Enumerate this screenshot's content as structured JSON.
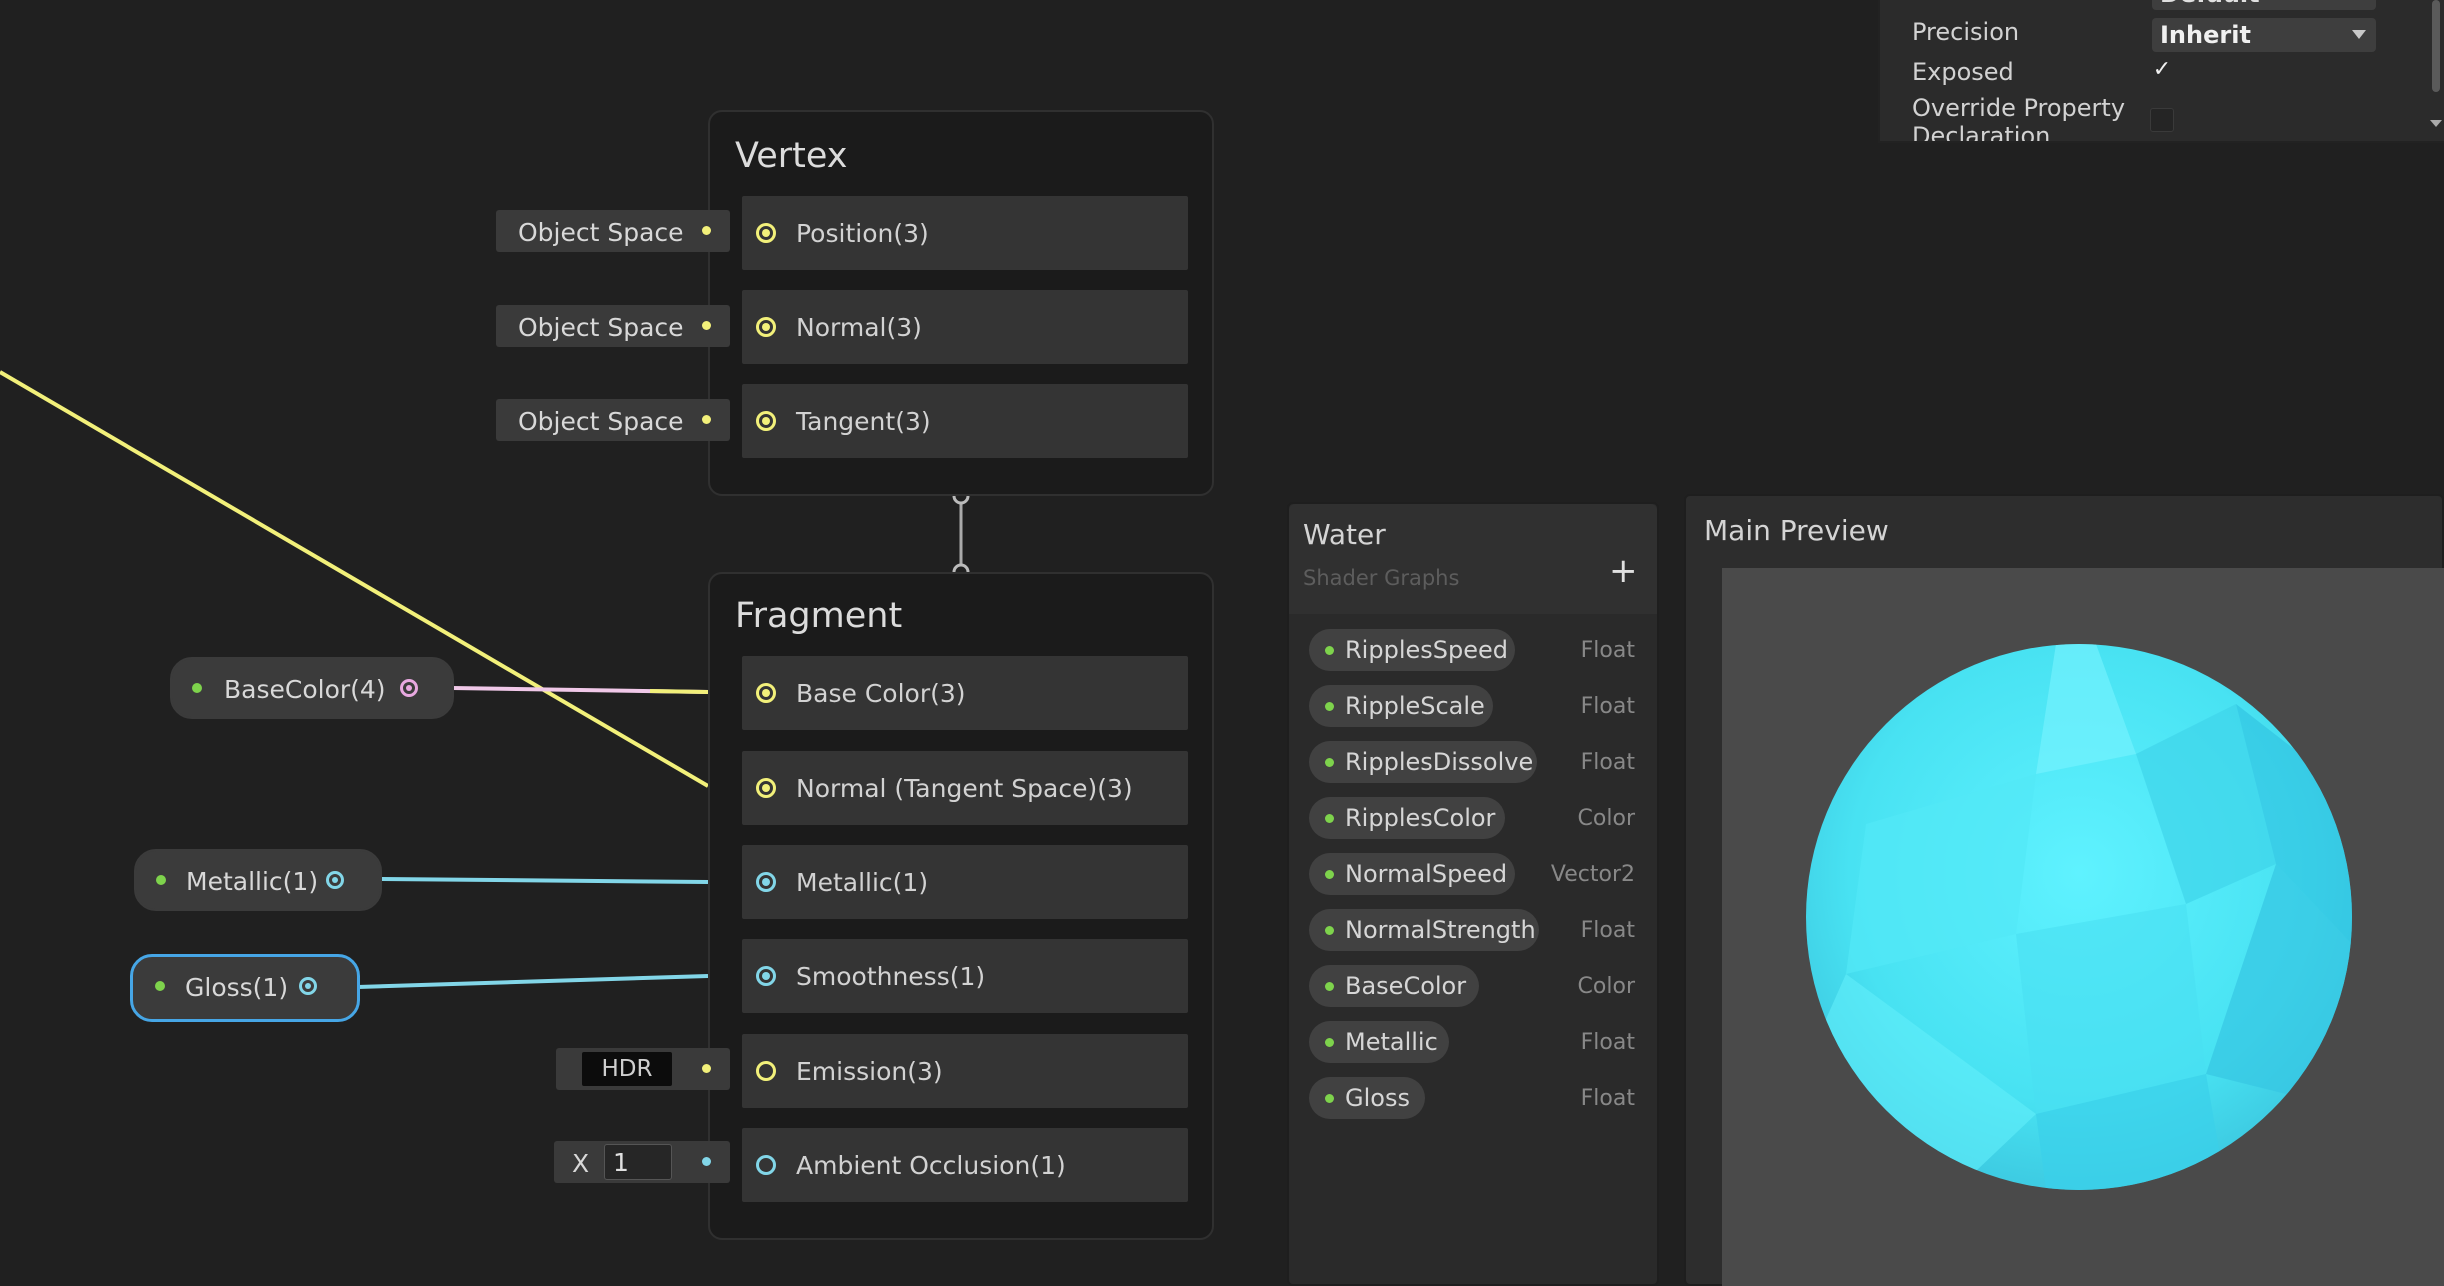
{
  "vertex": {
    "title": "Vertex",
    "slots": [
      {
        "label": "Position(3)",
        "input": "Object Space"
      },
      {
        "label": "Normal(3)",
        "input": "Object Space"
      },
      {
        "label": "Tangent(3)",
        "input": "Object Space"
      }
    ]
  },
  "fragment": {
    "title": "Fragment",
    "slots": [
      {
        "label": "Base Color(3)"
      },
      {
        "label": "Normal (Tangent Space)(3)"
      },
      {
        "label": "Metallic(1)"
      },
      {
        "label": "Smoothness(1)"
      },
      {
        "label": "Emission(3)",
        "input": "HDR"
      },
      {
        "label": "Ambient Occlusion(1)",
        "input_axis": "X",
        "input_value": "1"
      }
    ]
  },
  "property_nodes": [
    {
      "label": "BaseColor(4)",
      "port_color": "#e8a8e0"
    },
    {
      "label": "Metallic(1)",
      "port_color": "#82d6e8"
    },
    {
      "label": "Gloss(1)",
      "port_color": "#82d6e8",
      "selected": true
    }
  ],
  "blackboard": {
    "title": "Water",
    "subtitle": "Shader Graphs",
    "add_label": "+",
    "properties": [
      {
        "name": "RipplesSpeed",
        "type": "Float"
      },
      {
        "name": "RippleScale",
        "type": "Float"
      },
      {
        "name": "RipplesDissolve",
        "type": "Float"
      },
      {
        "name": "RipplesColor",
        "type": "Color"
      },
      {
        "name": "NormalSpeed",
        "type": "Vector2"
      },
      {
        "name": "NormalStrength",
        "type": "Float"
      },
      {
        "name": "BaseColor",
        "type": "Color"
      },
      {
        "name": "Metallic",
        "type": "Float"
      },
      {
        "name": "Gloss",
        "type": "Float"
      }
    ]
  },
  "preview": {
    "title": "Main Preview"
  },
  "inspector": {
    "default_value": "Default",
    "precision_label": "Precision",
    "precision_value": "Inherit",
    "exposed_label": "Exposed",
    "exposed_checked": "✓",
    "override_label_line1": "Override Property",
    "override_label_line2": "Declaration"
  },
  "colors": {
    "wire_vector3": "#f2f07a",
    "wire_float": "#82d6e8",
    "wire_vector4": "#f0c8e8",
    "property_dot": "#7ed34c",
    "selection": "#46a6e6",
    "water": "#4fe6f2"
  }
}
